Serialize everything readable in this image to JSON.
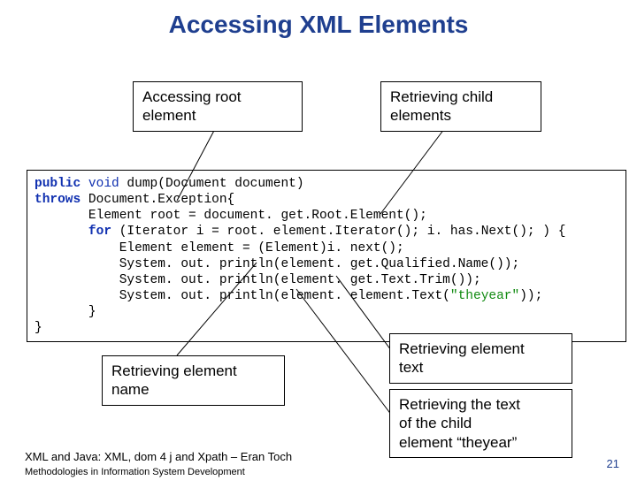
{
  "title": "Accessing XML Elements",
  "callouts": {
    "topLeft": {
      "l1": "Accessing root",
      "l2": "element"
    },
    "topRight": {
      "l1": "Retrieving child",
      "l2": "elements"
    },
    "bottomLeftUpper": {
      "l1": "Retrieving element",
      "l2": "name"
    },
    "bottomRightUpper": {
      "l1": "Retrieving element",
      "l2": "text"
    },
    "bottomRightLower": {
      "l1": "Retrieving the text",
      "l2": "of the child",
      "l3": "element “theyear”"
    }
  },
  "code": {
    "l1_kw1": "public",
    "l1_kw2": "void",
    "l1_rest": " dump(Document document)",
    "l2_kw": "throws",
    "l2_rest": " Document.Exception{",
    "l3": "       Element root = document. get.Root.Element();",
    "l4_pre": "       ",
    "l4_kw": "for",
    "l4_rest": " (Iterator i = root. element.Iterator(); i. has.Next(); ) {",
    "l5": "           Element element = (Element)i. next();",
    "l6": "           System. out. println(element. get.Qualified.Name());",
    "l7": "           System. out. println(element. get.Text.Trim());",
    "l8_pre": "           System. out. println(element. element.Text(",
    "l8_str": "\"theyear\"",
    "l8_post": "));",
    "l9": "       }",
    "l10": "}"
  },
  "footer": {
    "main": "XML and Java: XML, dom 4 j and Xpath – Eran Toch",
    "sub": "Methodologies in Information System Development"
  },
  "page": "21"
}
